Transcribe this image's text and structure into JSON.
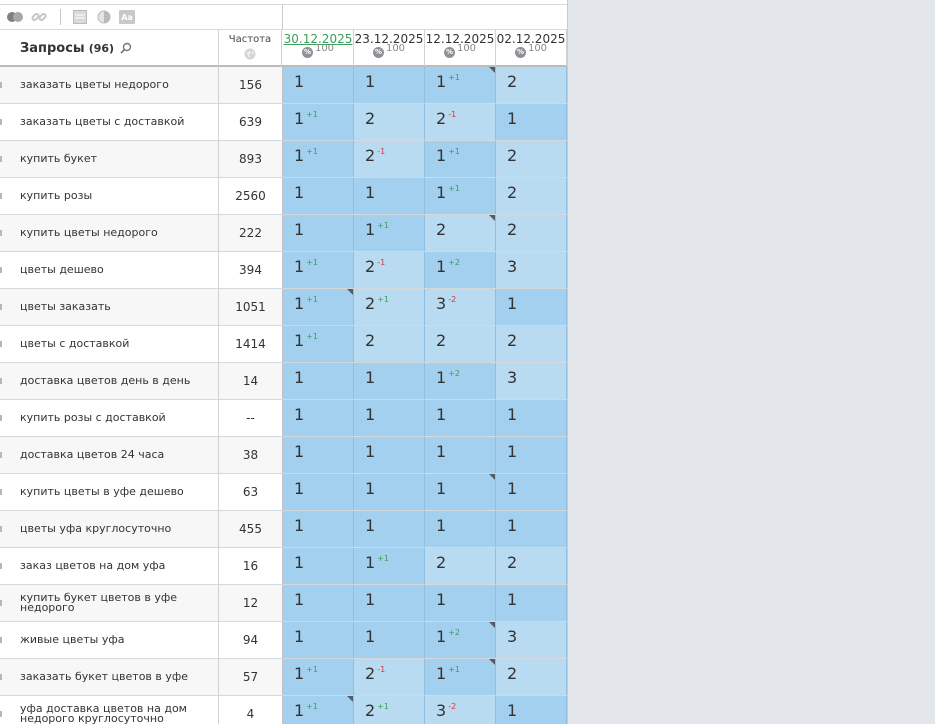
{
  "toolbar": {
    "icons": [
      "toggle-icon",
      "link-icon",
      "columns-icon",
      "contrast-icon",
      "font-size-icon"
    ],
    "font_label": "Aa"
  },
  "header": {
    "query_title": "Запросы",
    "query_count": "(96)",
    "freq_label": "Частота",
    "dates": [
      {
        "label": "30.12.2025",
        "pct": "100",
        "active": true
      },
      {
        "label": "23.12.2025",
        "pct": "100",
        "active": false
      },
      {
        "label": "12.12.2025",
        "pct": "100",
        "active": false
      },
      {
        "label": "02.12.2025",
        "pct": "100",
        "active": false
      }
    ],
    "badge_label": "%"
  },
  "rows": [
    {
      "query": "заказать цветы недорого",
      "freq": "156",
      "cells": [
        {
          "v": "1",
          "d": "",
          "c": false,
          "t": "dark"
        },
        {
          "v": "1",
          "d": "",
          "c": false,
          "t": "dark"
        },
        {
          "v": "1",
          "d": "+1",
          "c": true,
          "t": "dark"
        },
        {
          "v": "2",
          "d": "",
          "c": false,
          "t": "light"
        }
      ]
    },
    {
      "query": "заказать цветы с доставкой",
      "freq": "639",
      "cells": [
        {
          "v": "1",
          "d": "+1",
          "c": false,
          "t": "dark"
        },
        {
          "v": "2",
          "d": "",
          "c": false,
          "t": "light"
        },
        {
          "v": "2",
          "d": "-1",
          "c": false,
          "t": "light"
        },
        {
          "v": "1",
          "d": "",
          "c": false,
          "t": "dark"
        }
      ]
    },
    {
      "query": "купить букет",
      "freq": "893",
      "cells": [
        {
          "v": "1",
          "d": "+1",
          "c": false,
          "t": "dark"
        },
        {
          "v": "2",
          "d": "-1",
          "c": false,
          "t": "light"
        },
        {
          "v": "1",
          "d": "+1",
          "c": false,
          "t": "dark"
        },
        {
          "v": "2",
          "d": "",
          "c": false,
          "t": "light"
        }
      ]
    },
    {
      "query": "купить розы",
      "freq": "2560",
      "cells": [
        {
          "v": "1",
          "d": "",
          "c": false,
          "t": "dark"
        },
        {
          "v": "1",
          "d": "",
          "c": false,
          "t": "dark"
        },
        {
          "v": "1",
          "d": "+1",
          "c": false,
          "t": "dark"
        },
        {
          "v": "2",
          "d": "",
          "c": false,
          "t": "light"
        }
      ]
    },
    {
      "query": "купить цветы недорого",
      "freq": "222",
      "cells": [
        {
          "v": "1",
          "d": "",
          "c": false,
          "t": "dark"
        },
        {
          "v": "1",
          "d": "+1",
          "c": false,
          "t": "dark"
        },
        {
          "v": "2",
          "d": "",
          "c": true,
          "t": "light"
        },
        {
          "v": "2",
          "d": "",
          "c": false,
          "t": "light"
        }
      ]
    },
    {
      "query": "цветы дешево",
      "freq": "394",
      "cells": [
        {
          "v": "1",
          "d": "+1",
          "c": false,
          "t": "dark"
        },
        {
          "v": "2",
          "d": "-1",
          "c": false,
          "t": "light"
        },
        {
          "v": "1",
          "d": "+2",
          "c": false,
          "t": "dark"
        },
        {
          "v": "3",
          "d": "",
          "c": false,
          "t": "light"
        }
      ]
    },
    {
      "query": "цветы заказать",
      "freq": "1051",
      "cells": [
        {
          "v": "1",
          "d": "+1",
          "c": true,
          "t": "dark"
        },
        {
          "v": "2",
          "d": "+1",
          "c": false,
          "t": "light"
        },
        {
          "v": "3",
          "d": "-2",
          "c": false,
          "t": "light"
        },
        {
          "v": "1",
          "d": "",
          "c": false,
          "t": "dark"
        }
      ]
    },
    {
      "query": "цветы с доставкой",
      "freq": "1414",
      "cells": [
        {
          "v": "1",
          "d": "+1",
          "c": false,
          "t": "dark"
        },
        {
          "v": "2",
          "d": "",
          "c": false,
          "t": "light"
        },
        {
          "v": "2",
          "d": "",
          "c": false,
          "t": "light"
        },
        {
          "v": "2",
          "d": "",
          "c": false,
          "t": "light"
        }
      ]
    },
    {
      "query": "доставка цветов день в день",
      "freq": "14",
      "cells": [
        {
          "v": "1",
          "d": "",
          "c": false,
          "t": "dark"
        },
        {
          "v": "1",
          "d": "",
          "c": false,
          "t": "dark"
        },
        {
          "v": "1",
          "d": "+2",
          "c": false,
          "t": "dark"
        },
        {
          "v": "3",
          "d": "",
          "c": false,
          "t": "light"
        }
      ]
    },
    {
      "query": "купить розы с доставкой",
      "freq": "--",
      "cells": [
        {
          "v": "1",
          "d": "",
          "c": false,
          "t": "dark"
        },
        {
          "v": "1",
          "d": "",
          "c": false,
          "t": "dark"
        },
        {
          "v": "1",
          "d": "",
          "c": false,
          "t": "dark"
        },
        {
          "v": "1",
          "d": "",
          "c": false,
          "t": "dark"
        }
      ]
    },
    {
      "query": "доставка цветов 24 часа",
      "freq": "38",
      "cells": [
        {
          "v": "1",
          "d": "",
          "c": false,
          "t": "dark"
        },
        {
          "v": "1",
          "d": "",
          "c": false,
          "t": "dark"
        },
        {
          "v": "1",
          "d": "",
          "c": false,
          "t": "dark"
        },
        {
          "v": "1",
          "d": "",
          "c": false,
          "t": "dark"
        }
      ]
    },
    {
      "query": "купить цветы в уфе дешево",
      "freq": "63",
      "cells": [
        {
          "v": "1",
          "d": "",
          "c": false,
          "t": "dark"
        },
        {
          "v": "1",
          "d": "",
          "c": false,
          "t": "dark"
        },
        {
          "v": "1",
          "d": "",
          "c": true,
          "t": "dark"
        },
        {
          "v": "1",
          "d": "",
          "c": false,
          "t": "dark"
        }
      ]
    },
    {
      "query": "цветы уфа круглосуточно",
      "freq": "455",
      "cells": [
        {
          "v": "1",
          "d": "",
          "c": false,
          "t": "dark"
        },
        {
          "v": "1",
          "d": "",
          "c": false,
          "t": "dark"
        },
        {
          "v": "1",
          "d": "",
          "c": false,
          "t": "dark"
        },
        {
          "v": "1",
          "d": "",
          "c": false,
          "t": "dark"
        }
      ]
    },
    {
      "query": "заказ цветов на дом уфа",
      "freq": "16",
      "cells": [
        {
          "v": "1",
          "d": "",
          "c": false,
          "t": "dark"
        },
        {
          "v": "1",
          "d": "+1",
          "c": false,
          "t": "dark"
        },
        {
          "v": "2",
          "d": "",
          "c": false,
          "t": "light"
        },
        {
          "v": "2",
          "d": "",
          "c": false,
          "t": "light"
        }
      ]
    },
    {
      "query": "купить букет цветов в уфе недорого",
      "freq": "12",
      "cells": [
        {
          "v": "1",
          "d": "",
          "c": false,
          "t": "dark"
        },
        {
          "v": "1",
          "d": "",
          "c": false,
          "t": "dark"
        },
        {
          "v": "1",
          "d": "",
          "c": false,
          "t": "dark"
        },
        {
          "v": "1",
          "d": "",
          "c": false,
          "t": "dark"
        }
      ]
    },
    {
      "query": "живые цветы уфа",
      "freq": "94",
      "cells": [
        {
          "v": "1",
          "d": "",
          "c": false,
          "t": "dark"
        },
        {
          "v": "1",
          "d": "",
          "c": false,
          "t": "dark"
        },
        {
          "v": "1",
          "d": "+2",
          "c": true,
          "t": "dark"
        },
        {
          "v": "3",
          "d": "",
          "c": false,
          "t": "light"
        }
      ]
    },
    {
      "query": "заказать букет цветов в уфе",
      "freq": "57",
      "cells": [
        {
          "v": "1",
          "d": "+1",
          "c": false,
          "t": "dark"
        },
        {
          "v": "2",
          "d": "-1",
          "c": false,
          "t": "light"
        },
        {
          "v": "1",
          "d": "+1",
          "c": true,
          "t": "dark"
        },
        {
          "v": "2",
          "d": "",
          "c": false,
          "t": "light"
        }
      ]
    },
    {
      "query": "уфа доставка цветов на дом недорого круглосуточно",
      "freq": "4",
      "cells": [
        {
          "v": "1",
          "d": "+1",
          "c": true,
          "t": "dark"
        },
        {
          "v": "2",
          "d": "+1",
          "c": false,
          "t": "light"
        },
        {
          "v": "3",
          "d": "-2",
          "c": false,
          "t": "light"
        },
        {
          "v": "1",
          "d": "",
          "c": false,
          "t": "dark"
        }
      ]
    }
  ]
}
